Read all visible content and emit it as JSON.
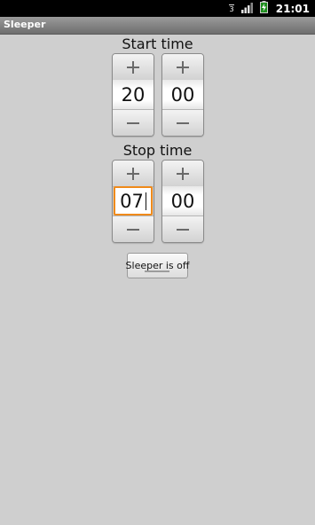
{
  "status_bar": {
    "time": "21:01",
    "icons": [
      "signal-strength-icon",
      "cell-signal-icon",
      "battery-charging-icon"
    ]
  },
  "app": {
    "title": "Sleeper"
  },
  "start": {
    "label": "Start time",
    "hour": "20",
    "minute": "00"
  },
  "stop": {
    "label": "Stop time",
    "hour": "07",
    "minute": "00"
  },
  "toggle": {
    "label": "Sleeper is off",
    "state": "off"
  },
  "colors": {
    "focus": "#ef8a1a",
    "background": "#cfcfcf"
  }
}
